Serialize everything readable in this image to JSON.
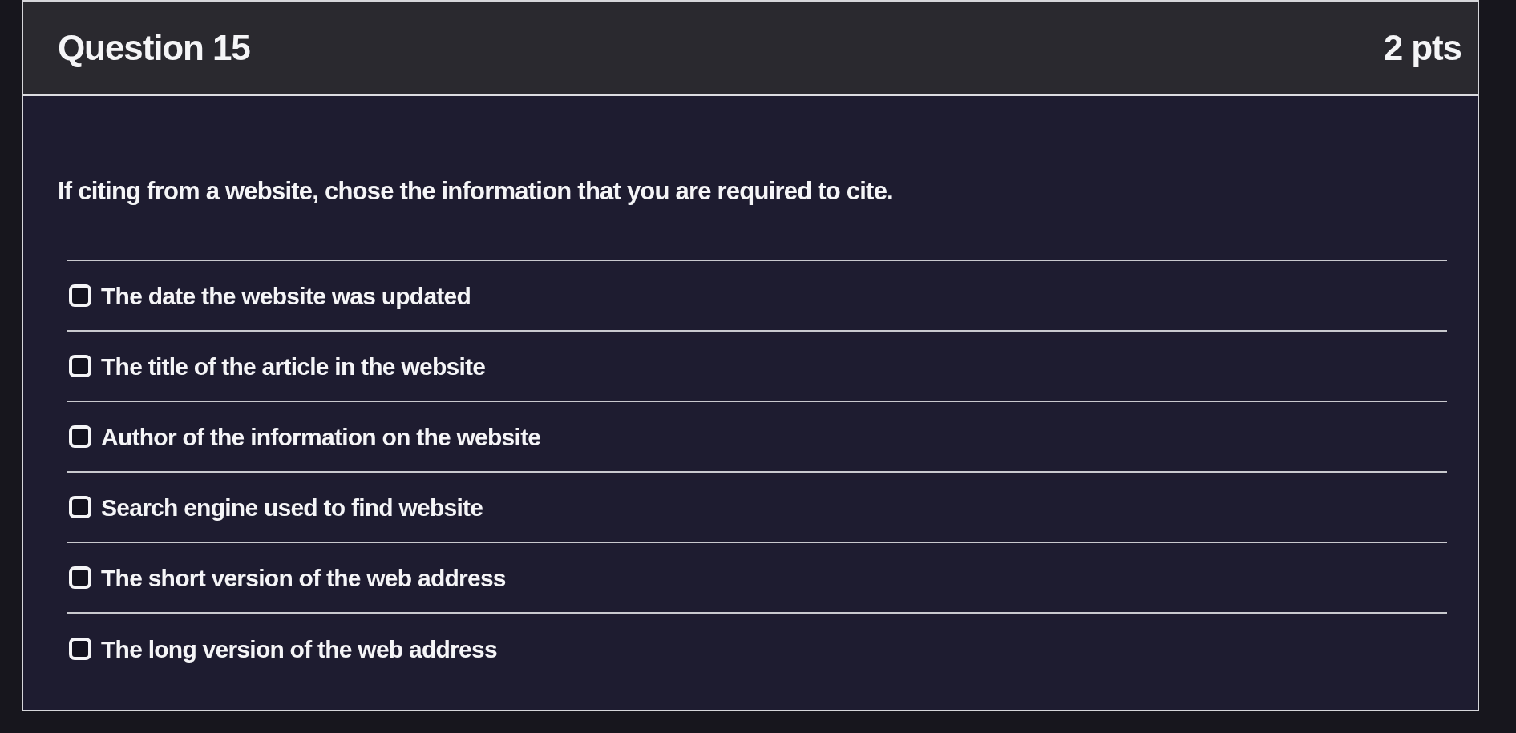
{
  "question": {
    "title": "Question 15",
    "points": "2 pts",
    "prompt": "If citing from a website, chose the information that you are required to cite.",
    "answers": [
      {
        "label": "The date the website was updated",
        "checked": false
      },
      {
        "label": "The title of the article in the website",
        "checked": false
      },
      {
        "label": "Author of the information on the website",
        "checked": false
      },
      {
        "label": "Search engine used to find website",
        "checked": false
      },
      {
        "label": "The short version of the web address",
        "checked": false
      },
      {
        "label": "The long version of the web address",
        "checked": false
      }
    ]
  }
}
